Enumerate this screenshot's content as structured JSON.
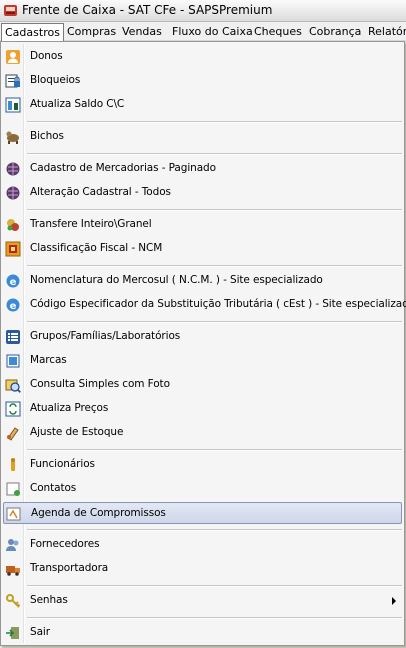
{
  "window": {
    "title": "Frente de Caixa - SAT CFe - SAPSPremium"
  },
  "menubar": {
    "items": [
      {
        "label": "Cadastros"
      },
      {
        "label": "Compras"
      },
      {
        "label": "Vendas"
      },
      {
        "label": "Fluxo do Caixa"
      },
      {
        "label": "Cheques"
      },
      {
        "label": "Cobrança"
      },
      {
        "label": "Relatór"
      }
    ]
  },
  "menu": {
    "items": [
      {
        "label": "Donos",
        "icon": "person-icon"
      },
      {
        "label": "Bloqueios",
        "icon": "lock-document-icon"
      },
      {
        "label": "Atualiza Saldo C\\C",
        "icon": "update-balance-icon"
      },
      {
        "label": "Bichos",
        "icon": "animal-icon"
      },
      {
        "label": "Cadastro de Mercadorias - Paginado",
        "icon": "goods-icon"
      },
      {
        "label": "Alteração Cadastral - Todos",
        "icon": "goods-edit-icon"
      },
      {
        "label": "Transfere Inteiro\\Granel",
        "icon": "transfer-icon"
      },
      {
        "label": "Classificação Fiscal - NCM",
        "icon": "fiscal-icon"
      },
      {
        "label": "Nomenclatura do Mercosul ( N.C.M. ) - Site especializado",
        "icon": "internet-explorer-icon"
      },
      {
        "label": "Código Especificador da Substituição Tributária ( cEst ) - Site especializado",
        "icon": "internet-explorer-icon"
      },
      {
        "label": "Grupos/Famílias/Laboratórios",
        "icon": "list-icon"
      },
      {
        "label": "Marcas",
        "icon": "brand-icon"
      },
      {
        "label": "Consulta Simples com Foto",
        "icon": "photo-search-icon"
      },
      {
        "label": "Atualiza Preços",
        "icon": "update-price-icon"
      },
      {
        "label": "Ajuste de Estoque",
        "icon": "stock-adjust-icon"
      },
      {
        "label": "Funcionários",
        "icon": "employee-icon"
      },
      {
        "label": "Contatos",
        "icon": "contacts-icon"
      },
      {
        "label": "Agenda de Compromissos",
        "icon": "agenda-icon"
      },
      {
        "label": "Fornecedores",
        "icon": "suppliers-icon"
      },
      {
        "label": "Transportadora",
        "icon": "truck-icon"
      },
      {
        "label": "Senhas",
        "icon": "keys-icon"
      },
      {
        "label": "Sair",
        "icon": "exit-icon"
      }
    ],
    "highlighted": "Agenda de Compromissos"
  },
  "colors": {
    "highlight_border": "#8b95b3",
    "menu_bg": "#f5f5f5"
  }
}
